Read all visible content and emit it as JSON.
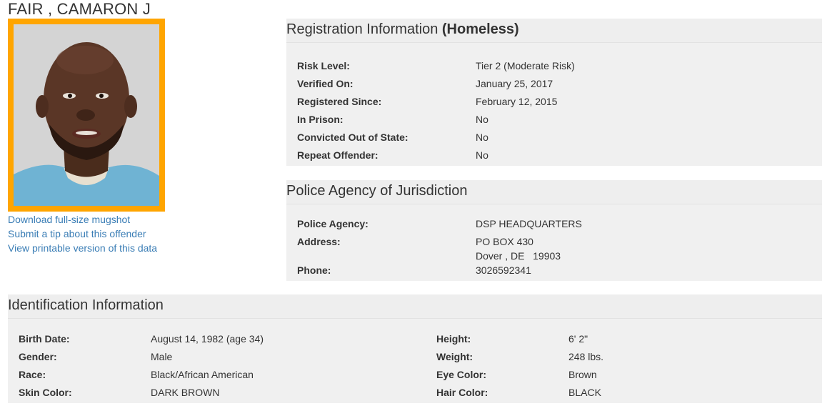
{
  "offender_name": "FAIR , CAMARON J",
  "colors": {
    "photo_border": "#ffa500",
    "link": "#3a7db5",
    "panel_bg": "#f0f0f0"
  },
  "links": [
    "Download full-size mugshot",
    "Submit a tip about this offender",
    "View printable version of this data"
  ],
  "registration": {
    "title": "Registration Information",
    "status": "(Homeless)",
    "rows": [
      {
        "label": "Risk Level:",
        "value": "Tier 2 (Moderate Risk)"
      },
      {
        "label": "Verified On:",
        "value": "January 25, 2017"
      },
      {
        "label": "Registered Since:",
        "value": "February 12, 2015"
      },
      {
        "label": "In Prison:",
        "value": "No"
      },
      {
        "label": "Convicted Out of State:",
        "value": "No"
      },
      {
        "label": "Repeat Offender:",
        "value": "No"
      }
    ]
  },
  "police": {
    "title": "Police Agency of Jurisdiction",
    "agency_label": "Police Agency:",
    "agency_value": "DSP HEADQUARTERS",
    "address_label": "Address:",
    "address_line1": "PO BOX 430",
    "address_line2": "Dover , DE   19903",
    "phone_label": "Phone:",
    "phone_value": "3026592341"
  },
  "identification": {
    "title": "Identification Information",
    "left": [
      {
        "label": "Birth Date:",
        "value": "August 14, 1982 (age 34)"
      },
      {
        "label": "Gender:",
        "value": "Male"
      },
      {
        "label": "Race:",
        "value": "Black/African American"
      },
      {
        "label": "Skin Color:",
        "value": "DARK BROWN"
      }
    ],
    "right": [
      {
        "label": "Height:",
        "value": "6' 2\""
      },
      {
        "label": "Weight:",
        "value": "248 lbs."
      },
      {
        "label": "Eye Color:",
        "value": "Brown"
      },
      {
        "label": "Hair Color:",
        "value": "BLACK"
      }
    ]
  }
}
